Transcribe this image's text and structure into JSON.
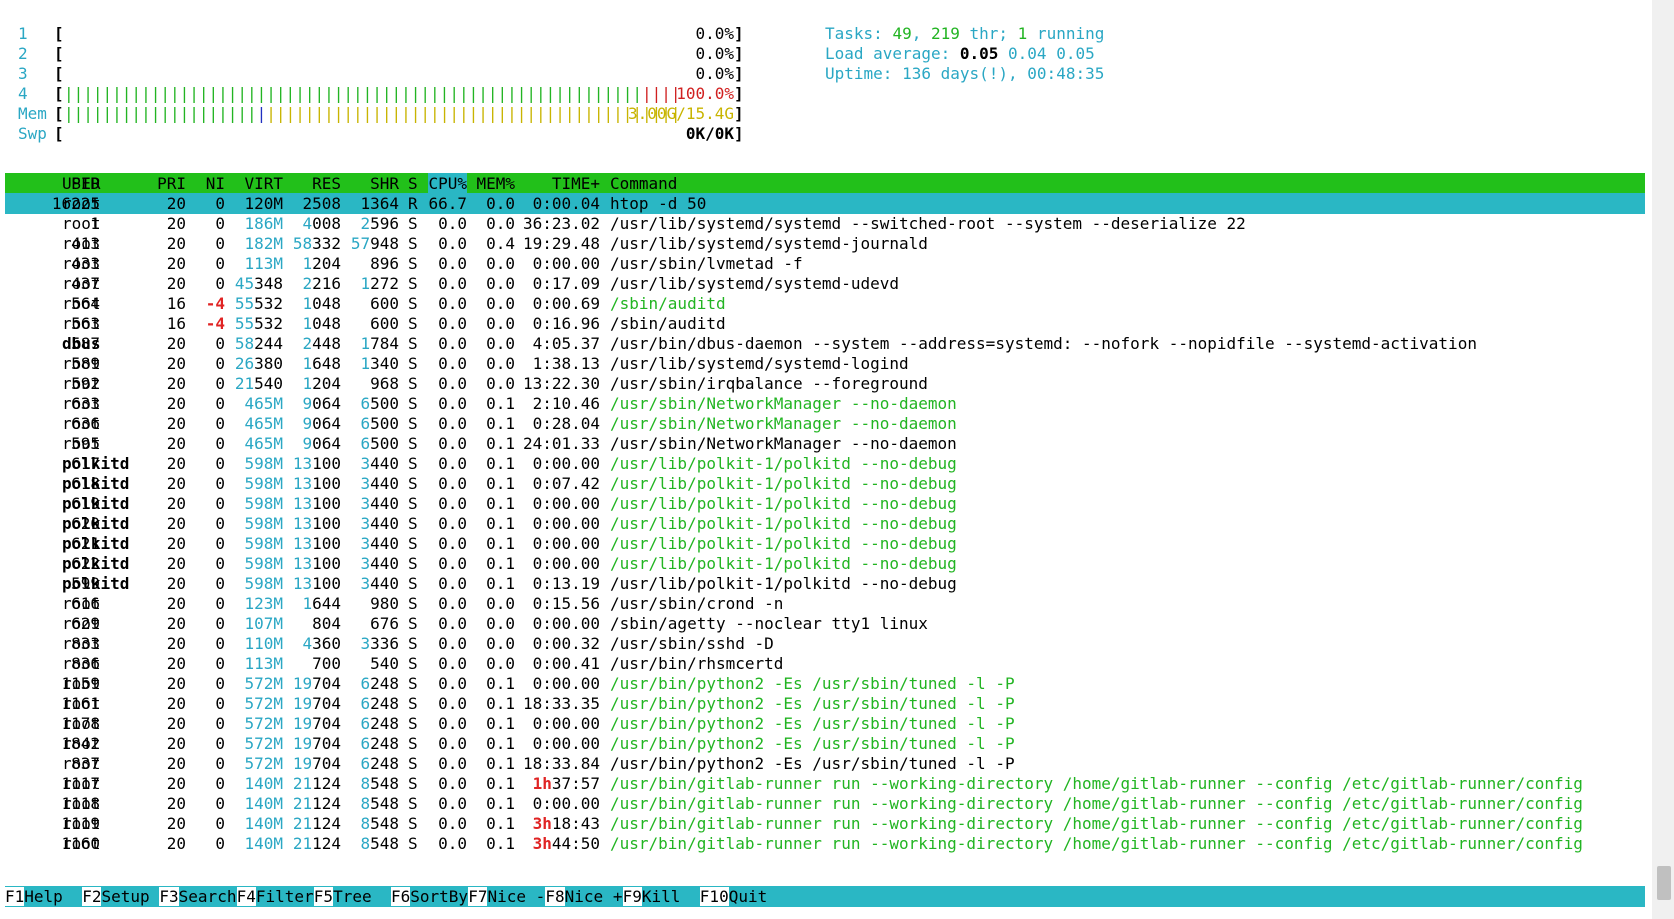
{
  "meters": [
    {
      "num": "1",
      "bar": "",
      "value": "0.0%"
    },
    {
      "num": "2",
      "bar": "",
      "value": "0.0%"
    },
    {
      "num": "3",
      "bar": "",
      "value": "0.0%"
    },
    {
      "num": "4",
      "bar_green": "||||||||||||||||||||||||||||||||||||||||||||||||||||||||||||",
      "bar_red": "||||||||||||||||||||||||||||||||||||||||||||||",
      "value": "100.0%"
    },
    {
      "num": "Mem",
      "bar_green": "||||||||||||||||||||",
      "bar_blue": "|",
      "bar_yellow": "||||||||||||||||||||||||||||||||||||||||||||||||||||||",
      "value": "3.00G/15.4G"
    },
    {
      "num": "Swp",
      "bar": "",
      "value": "0K/0K"
    }
  ],
  "tasks": {
    "label": "Tasks: ",
    "count": "49",
    "sep": ", ",
    "threads": "219",
    "thr": " thr",
    "sep2": "; ",
    "running": "1",
    "running_label": " running"
  },
  "load": {
    "label": "Load average: ",
    "one": "0.05",
    "five": "0.04",
    "fifteen": "0.05"
  },
  "uptime": {
    "label": "Uptime: ",
    "value": "136 days(!), 00:48:35"
  },
  "columns": {
    "pid": "PID",
    "user": "USER",
    "pri": "PRI",
    "ni": "NI",
    "virt": "VIRT",
    "res": "RES",
    "shr": "SHR",
    "s": "S",
    "cpu": "CPU%",
    "mem": "MEM%",
    "time": "TIME+",
    "cmd": "Command"
  },
  "processes": [
    {
      "pid": "16225",
      "user": "root",
      "pri": "20",
      "ni": "0",
      "virt": "120M",
      "res": "2508",
      "shr": "1364",
      "s": "R",
      "cpu": "66.7",
      "mem": "0.0",
      "time": "0:00.04",
      "cmd": "htop -d 50",
      "selected": true
    },
    {
      "pid": "1",
      "user": "root",
      "pri": "20",
      "ni": "0",
      "virt": "186M",
      "res": "4008",
      "shr": "2596",
      "s": "S",
      "cpu": "0.0",
      "mem": "0.0",
      "time": "36:23.02",
      "cmd": "/usr/lib/systemd/systemd --switched-root --system --deserialize 22"
    },
    {
      "pid": "413",
      "user": "root",
      "pri": "20",
      "ni": "0",
      "virt": "182M",
      "res": "58332",
      "shr": "57948",
      "s": "S",
      "cpu": "0.0",
      "mem": "0.4",
      "time": "19:29.48",
      "cmd": "/usr/lib/systemd/systemd-journald"
    },
    {
      "pid": "433",
      "user": "root",
      "pri": "20",
      "ni": "0",
      "virt": "113M",
      "res": "1204",
      "shr": "896",
      "s": "S",
      "cpu": "0.0",
      "mem": "0.0",
      "time": "0:00.00",
      "cmd": "/usr/sbin/lvmetad -f"
    },
    {
      "pid": "437",
      "user": "root",
      "pri": "20",
      "ni": "0",
      "virt": "45348",
      "res": "2216",
      "shr": "1272",
      "s": "S",
      "cpu": "0.0",
      "mem": "0.0",
      "time": "0:17.09",
      "cmd": "/usr/lib/systemd/systemd-udevd"
    },
    {
      "pid": "564",
      "user": "root",
      "pri": "16",
      "ni": "-4",
      "virt": "55532",
      "res": "1048",
      "shr": "600",
      "s": "S",
      "cpu": "0.0",
      "mem": "0.0",
      "time": "0:00.69",
      "cmd": "/sbin/auditd",
      "thread": true
    },
    {
      "pid": "563",
      "user": "root",
      "pri": "16",
      "ni": "-4",
      "virt": "55532",
      "res": "1048",
      "shr": "600",
      "s": "S",
      "cpu": "0.0",
      "mem": "0.0",
      "time": "0:16.96",
      "cmd": "/sbin/auditd"
    },
    {
      "pid": "587",
      "user": "dbus",
      "pri": "20",
      "ni": "0",
      "virt": "58244",
      "res": "2448",
      "shr": "1784",
      "s": "S",
      "cpu": "0.0",
      "mem": "0.0",
      "time": "4:05.37",
      "cmd": "/usr/bin/dbus-daemon --system --address=systemd: --nofork --nopidfile --systemd-activation",
      "bolduser": true
    },
    {
      "pid": "589",
      "user": "root",
      "pri": "20",
      "ni": "0",
      "virt": "26380",
      "res": "1648",
      "shr": "1340",
      "s": "S",
      "cpu": "0.0",
      "mem": "0.0",
      "time": "1:38.13",
      "cmd": "/usr/lib/systemd/systemd-logind"
    },
    {
      "pid": "592",
      "user": "root",
      "pri": "20",
      "ni": "0",
      "virt": "21540",
      "res": "1204",
      "shr": "968",
      "s": "S",
      "cpu": "0.0",
      "mem": "0.0",
      "time": "13:22.30",
      "cmd": "/usr/sbin/irqbalance --foreground"
    },
    {
      "pid": "633",
      "user": "root",
      "pri": "20",
      "ni": "0",
      "virt": "465M",
      "res": "9064",
      "shr": "6500",
      "s": "S",
      "cpu": "0.0",
      "mem": "0.1",
      "time": "2:10.46",
      "cmd": "/usr/sbin/NetworkManager --no-daemon",
      "thread": true
    },
    {
      "pid": "636",
      "user": "root",
      "pri": "20",
      "ni": "0",
      "virt": "465M",
      "res": "9064",
      "shr": "6500",
      "s": "S",
      "cpu": "0.0",
      "mem": "0.1",
      "time": "0:28.04",
      "cmd": "/usr/sbin/NetworkManager --no-daemon",
      "thread": true
    },
    {
      "pid": "595",
      "user": "root",
      "pri": "20",
      "ni": "0",
      "virt": "465M",
      "res": "9064",
      "shr": "6500",
      "s": "S",
      "cpu": "0.0",
      "mem": "0.1",
      "time": "24:01.33",
      "cmd": "/usr/sbin/NetworkManager --no-daemon"
    },
    {
      "pid": "617",
      "user": "polkitd",
      "pri": "20",
      "ni": "0",
      "virt": "598M",
      "res": "13100",
      "shr": "3440",
      "s": "S",
      "cpu": "0.0",
      "mem": "0.1",
      "time": "0:00.00",
      "cmd": "/usr/lib/polkit-1/polkitd --no-debug",
      "thread": true,
      "bolduser": true
    },
    {
      "pid": "618",
      "user": "polkitd",
      "pri": "20",
      "ni": "0",
      "virt": "598M",
      "res": "13100",
      "shr": "3440",
      "s": "S",
      "cpu": "0.0",
      "mem": "0.1",
      "time": "0:07.42",
      "cmd": "/usr/lib/polkit-1/polkitd --no-debug",
      "thread": true,
      "bolduser": true
    },
    {
      "pid": "619",
      "user": "polkitd",
      "pri": "20",
      "ni": "0",
      "virt": "598M",
      "res": "13100",
      "shr": "3440",
      "s": "S",
      "cpu": "0.0",
      "mem": "0.1",
      "time": "0:00.00",
      "cmd": "/usr/lib/polkit-1/polkitd --no-debug",
      "thread": true,
      "bolduser": true
    },
    {
      "pid": "620",
      "user": "polkitd",
      "pri": "20",
      "ni": "0",
      "virt": "598M",
      "res": "13100",
      "shr": "3440",
      "s": "S",
      "cpu": "0.0",
      "mem": "0.1",
      "time": "0:00.00",
      "cmd": "/usr/lib/polkit-1/polkitd --no-debug",
      "thread": true,
      "bolduser": true
    },
    {
      "pid": "621",
      "user": "polkitd",
      "pri": "20",
      "ni": "0",
      "virt": "598M",
      "res": "13100",
      "shr": "3440",
      "s": "S",
      "cpu": "0.0",
      "mem": "0.1",
      "time": "0:00.00",
      "cmd": "/usr/lib/polkit-1/polkitd --no-debug",
      "thread": true,
      "bolduser": true
    },
    {
      "pid": "622",
      "user": "polkitd",
      "pri": "20",
      "ni": "0",
      "virt": "598M",
      "res": "13100",
      "shr": "3440",
      "s": "S",
      "cpu": "0.0",
      "mem": "0.1",
      "time": "0:00.00",
      "cmd": "/usr/lib/polkit-1/polkitd --no-debug",
      "thread": true,
      "bolduser": true
    },
    {
      "pid": "599",
      "user": "polkitd",
      "pri": "20",
      "ni": "0",
      "virt": "598M",
      "res": "13100",
      "shr": "3440",
      "s": "S",
      "cpu": "0.0",
      "mem": "0.1",
      "time": "0:13.19",
      "cmd": "/usr/lib/polkit-1/polkitd --no-debug",
      "bolduser": true
    },
    {
      "pid": "616",
      "user": "root",
      "pri": "20",
      "ni": "0",
      "virt": "123M",
      "res": "1644",
      "shr": "980",
      "s": "S",
      "cpu": "0.0",
      "mem": "0.0",
      "time": "0:15.56",
      "cmd": "/usr/sbin/crond -n"
    },
    {
      "pid": "629",
      "user": "root",
      "pri": "20",
      "ni": "0",
      "virt": "107M",
      "res": "804",
      "shr": "676",
      "s": "S",
      "cpu": "0.0",
      "mem": "0.0",
      "time": "0:00.00",
      "cmd": "/sbin/agetty --noclear tty1 linux"
    },
    {
      "pid": "833",
      "user": "root",
      "pri": "20",
      "ni": "0",
      "virt": "110M",
      "res": "4360",
      "shr": "3336",
      "s": "S",
      "cpu": "0.0",
      "mem": "0.0",
      "time": "0:00.32",
      "cmd": "/usr/sbin/sshd -D"
    },
    {
      "pid": "836",
      "user": "root",
      "pri": "20",
      "ni": "0",
      "virt": "113M",
      "res": "700",
      "shr": "540",
      "s": "S",
      "cpu": "0.0",
      "mem": "0.0",
      "time": "0:00.41",
      "cmd": "/usr/bin/rhsmcertd"
    },
    {
      "pid": "1159",
      "user": "root",
      "pri": "20",
      "ni": "0",
      "virt": "572M",
      "res": "19704",
      "shr": "6248",
      "s": "S",
      "cpu": "0.0",
      "mem": "0.1",
      "time": "0:00.00",
      "cmd": "/usr/bin/python2 -Es /usr/sbin/tuned -l -P",
      "thread": true
    },
    {
      "pid": "1161",
      "user": "root",
      "pri": "20",
      "ni": "0",
      "virt": "572M",
      "res": "19704",
      "shr": "6248",
      "s": "S",
      "cpu": "0.0",
      "mem": "0.1",
      "time": "18:33.35",
      "cmd": "/usr/bin/python2 -Es /usr/sbin/tuned -l -P",
      "thread": true
    },
    {
      "pid": "1178",
      "user": "root",
      "pri": "20",
      "ni": "0",
      "virt": "572M",
      "res": "19704",
      "shr": "6248",
      "s": "S",
      "cpu": "0.0",
      "mem": "0.1",
      "time": "0:00.00",
      "cmd": "/usr/bin/python2 -Es /usr/sbin/tuned -l -P",
      "thread": true
    },
    {
      "pid": "1842",
      "user": "root",
      "pri": "20",
      "ni": "0",
      "virt": "572M",
      "res": "19704",
      "shr": "6248",
      "s": "S",
      "cpu": "0.0",
      "mem": "0.1",
      "time": "0:00.00",
      "cmd": "/usr/bin/python2 -Es /usr/sbin/tuned -l -P",
      "thread": true
    },
    {
      "pid": "837",
      "user": "root",
      "pri": "20",
      "ni": "0",
      "virt": "572M",
      "res": "19704",
      "shr": "6248",
      "s": "S",
      "cpu": "0.0",
      "mem": "0.1",
      "time": "18:33.84",
      "cmd": "/usr/bin/python2 -Es /usr/sbin/tuned -l -P"
    },
    {
      "pid": "1117",
      "user": "root",
      "pri": "20",
      "ni": "0",
      "virt": "140M",
      "res": "21124",
      "shr": "8548",
      "s": "S",
      "cpu": "0.0",
      "mem": "0.1",
      "time_hl": "1h",
      "time": "37:57",
      "cmd": "/usr/bin/gitlab-runner run --working-directory /home/gitlab-runner --config /etc/gitlab-runner/config",
      "thread": true
    },
    {
      "pid": "1118",
      "user": "root",
      "pri": "20",
      "ni": "0",
      "virt": "140M",
      "res": "21124",
      "shr": "8548",
      "s": "S",
      "cpu": "0.0",
      "mem": "0.1",
      "time": "0:00.00",
      "cmd": "/usr/bin/gitlab-runner run --working-directory /home/gitlab-runner --config /etc/gitlab-runner/config",
      "thread": true
    },
    {
      "pid": "1119",
      "user": "root",
      "pri": "20",
      "ni": "0",
      "virt": "140M",
      "res": "21124",
      "shr": "8548",
      "s": "S",
      "cpu": "0.0",
      "mem": "0.1",
      "time_hl": "3h",
      "time": "18:43",
      "cmd": "/usr/bin/gitlab-runner run --working-directory /home/gitlab-runner --config /etc/gitlab-runner/config",
      "thread": true
    },
    {
      "pid": "1160",
      "user": "root",
      "pri": "20",
      "ni": "0",
      "virt": "140M",
      "res": "21124",
      "shr": "8548",
      "s": "S",
      "cpu": "0.0",
      "mem": "0.1",
      "time_hl": "3h",
      "time": "44:50",
      "cmd": "/usr/bin/gitlab-runner run --working-directory /home/gitlab-runner --config /etc/gitlab-runner/config",
      "thread": true
    }
  ],
  "fkeys": [
    {
      "key": "F1",
      "label": "Help  "
    },
    {
      "key": "F2",
      "label": "Setup "
    },
    {
      "key": "F3",
      "label": "Search"
    },
    {
      "key": "F4",
      "label": "Filter"
    },
    {
      "key": "F5",
      "label": "Tree  "
    },
    {
      "key": "F6",
      "label": "SortBy"
    },
    {
      "key": "F7",
      "label": "Nice -"
    },
    {
      "key": "F8",
      "label": "Nice +"
    },
    {
      "key": "F9",
      "label": "Kill  "
    },
    {
      "key": "F10",
      "label": "Quit  "
    }
  ],
  "colors": {
    "header_green": "#22c01a",
    "selected_cyan": "#2ab7c4",
    "thread_green": "#22b422",
    "accent_cyan": "#2aa7c4"
  }
}
